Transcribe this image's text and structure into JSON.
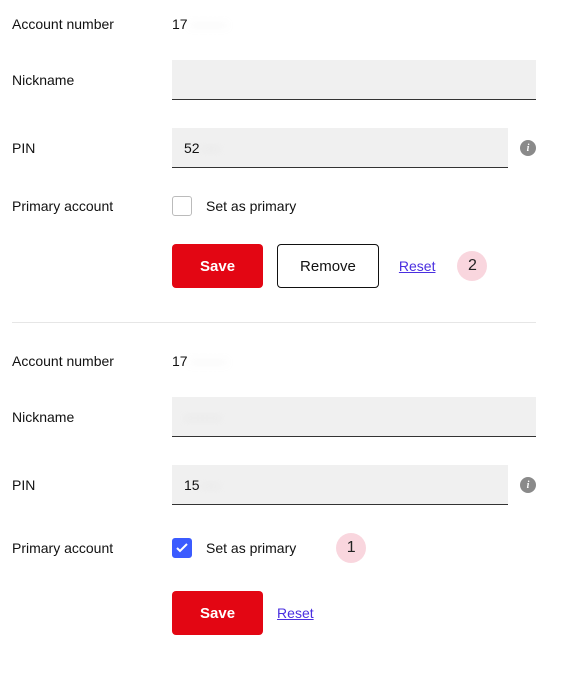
{
  "labels": {
    "account_number": "Account number",
    "nickname": "Nickname",
    "pin": "PIN",
    "primary_account": "Primary account",
    "set_as_primary": "Set as primary",
    "save": "Save",
    "remove": "Remove",
    "reset": "Reset",
    "info_glyph": "i"
  },
  "accounts": [
    {
      "number_prefix": "17",
      "number_rest": "········",
      "nickname": "",
      "pin_prefix": "52",
      "pin_rest": "····",
      "primary": false,
      "show_remove": true,
      "badge": "2"
    },
    {
      "number_prefix": "17",
      "number_rest": "········",
      "nickname_prefix": "",
      "nickname_rest": "········",
      "pin_prefix": "15",
      "pin_rest": "····",
      "primary": true,
      "show_remove": false,
      "badge": "1"
    }
  ]
}
